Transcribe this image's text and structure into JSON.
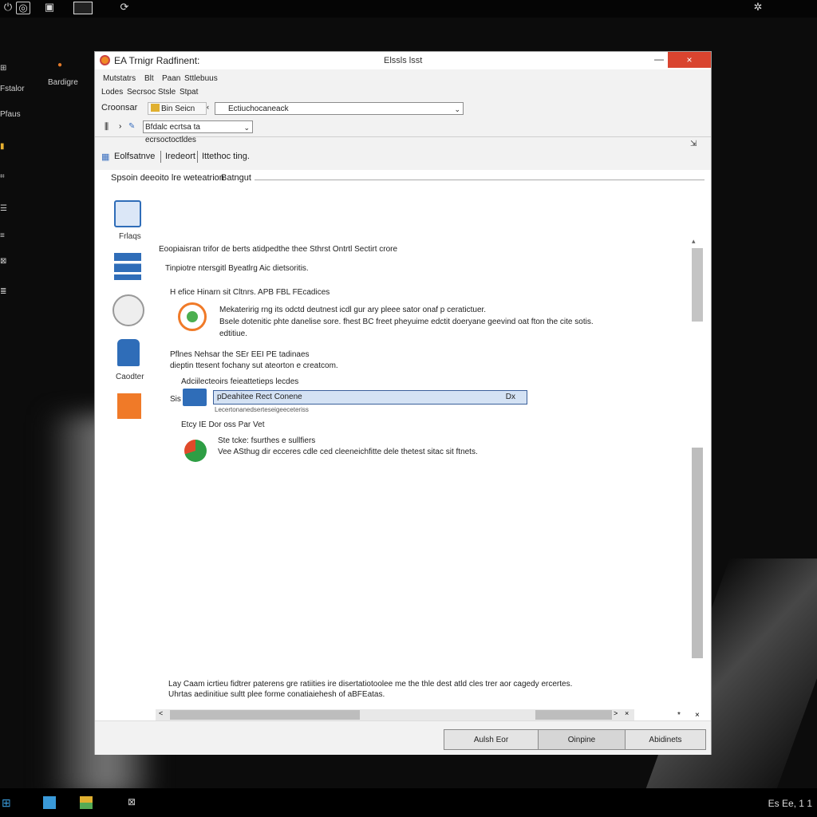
{
  "desktop": {
    "top_icons": [
      "power-icon",
      "user-icon",
      "monitor-icon",
      "refresh-icon",
      "network-icon"
    ],
    "left_labels": [
      "Fstalor",
      "Bardigre",
      "Pfaus"
    ],
    "taskbar_clock": "Es Ee, 1 1"
  },
  "window": {
    "title": "EA Trnigr Radfinent:",
    "subtitle": "Elssls lsst",
    "minimize": "—",
    "close": "×",
    "menu": [
      "Mutstatrs",
      "Blt",
      "Paan",
      "Sttlebuus"
    ],
    "submenu": [
      "Lodes",
      "Secrsoc Stsle",
      "Stpat"
    ],
    "toolbar": {
      "label": "Croonsar",
      "combo1": "Bin Seicn",
      "combo2": "Ectiuchocaneack"
    },
    "address": {
      "value": "Bfdalc ecrtsa ta ecrsoctoctldes"
    },
    "corner_icon": "pin-icon",
    "tabs": [
      "Eolfsatnve",
      "Iredeort",
      "Ittethoc ting."
    ],
    "section_header": "Spsoin deeoito lre weteatrion",
    "section_tag": "Batngut",
    "sidebar": [
      {
        "label": "Frlaqs",
        "icon": "monitor-icon"
      },
      {
        "label": "",
        "icon": "list-icon"
      },
      {
        "label": "",
        "icon": "disk-icon"
      },
      {
        "label": "Caodter",
        "icon": "bag-icon"
      },
      {
        "label": "",
        "icon": "package-icon"
      }
    ],
    "body": {
      "line1": "Eoopiaisran trifor de berts atidpedthe thee Sthrst Ontrtl Sectirt crore",
      "line2": "Tinpiotre ntersgitl Byeatlrg Aic dietsoritis.",
      "group1_head": "H efice Hinarn sit Cltnrs. APB FBL FEcadices",
      "group1_l1": "Mekateririg rng its odctd deutnest icdl gur ary pleee sator onaf p ceratictuer.",
      "group1_l2": "Bsele dotenitic phte danelise sore. fhest BC freet pheyuime edctit doeryane geevind oat fton the cite sotis.",
      "group1_l3": "edtitiue.",
      "group2_l1": "Pflnes Nehsar the SEr EEI PE tadinaes",
      "group2_l2": "dieptin ttesent fochany sut ateorton e creatcom.",
      "group3_head": "Adciilecteoirs feieattetieps lecdes",
      "sel_prefix": "Sis",
      "sel_value": "pDeahitee Rect Conene",
      "sel_clear": "Dx",
      "sel_sub": "Lecertonanedserteseigeeceteriss",
      "group4_head": "Etcy IE Dor oss Par Vet",
      "group4_l1": "Ste tcke: fsurthes e sullfiers",
      "group4_l2": "Vee ASthug dir ecceres cdle ced cleeneichfitte dele thetest sitac sit ftnets."
    },
    "hscroll_arrows": [
      "<",
      ">",
      "*",
      "×",
      "*",
      "×"
    ],
    "description_l1": "Lay Caam icrtieu fidtrer paterens gre ratiities ire disertatiotoolee me the thle dest atld cles trer aor cagedy ercertes.",
    "description_l2": "Uhrtas aedinitiue sultt plee forme conatiaiehesh of aBFEatas.",
    "buttons": [
      "Aulsh Eor",
      "Oinpine",
      "Abidinets"
    ]
  }
}
